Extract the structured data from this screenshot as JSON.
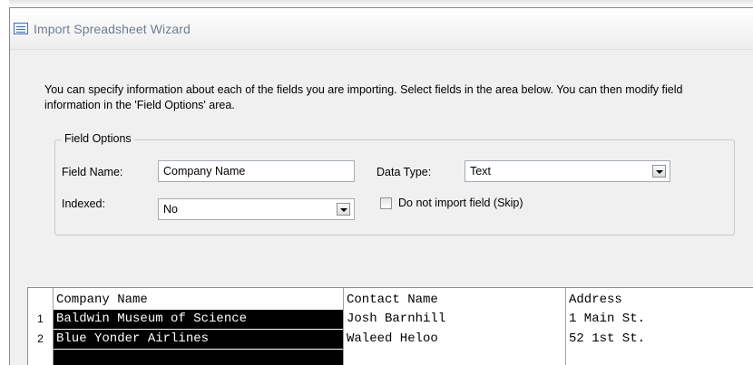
{
  "window": {
    "title": "Import Spreadsheet Wizard"
  },
  "intro": {
    "line1": "You can specify information about each of the fields you are importing. Select fields in the area below. You can then modify field",
    "line2": "information in the 'Field Options' area."
  },
  "field_options": {
    "legend": "Field Options",
    "field_name_label": "Field Name:",
    "field_name_value": "Company Name",
    "data_type_label": "Data Type:",
    "data_type_value": "Text",
    "indexed_label": "Indexed:",
    "indexed_value": "No",
    "skip_label": "Do not import field (Skip)",
    "skip_checked": false
  },
  "grid": {
    "columns": [
      "Company Name",
      "Contact Name",
      "Address"
    ],
    "rows": [
      {
        "num": "1",
        "cells": [
          "Baldwin Museum of Science",
          "Josh Barnhill",
          "1 Main St."
        ]
      },
      {
        "num": "2",
        "cells": [
          "Blue Yonder Airlines",
          "Waleed Heloo",
          "52 1st St."
        ]
      }
    ],
    "selected_column": 0
  },
  "colors": {
    "dialog_bg": "#f0f0f0",
    "title_text": "#6e7d92",
    "selection_bg": "#000000",
    "selection_text": "#ffffff"
  }
}
